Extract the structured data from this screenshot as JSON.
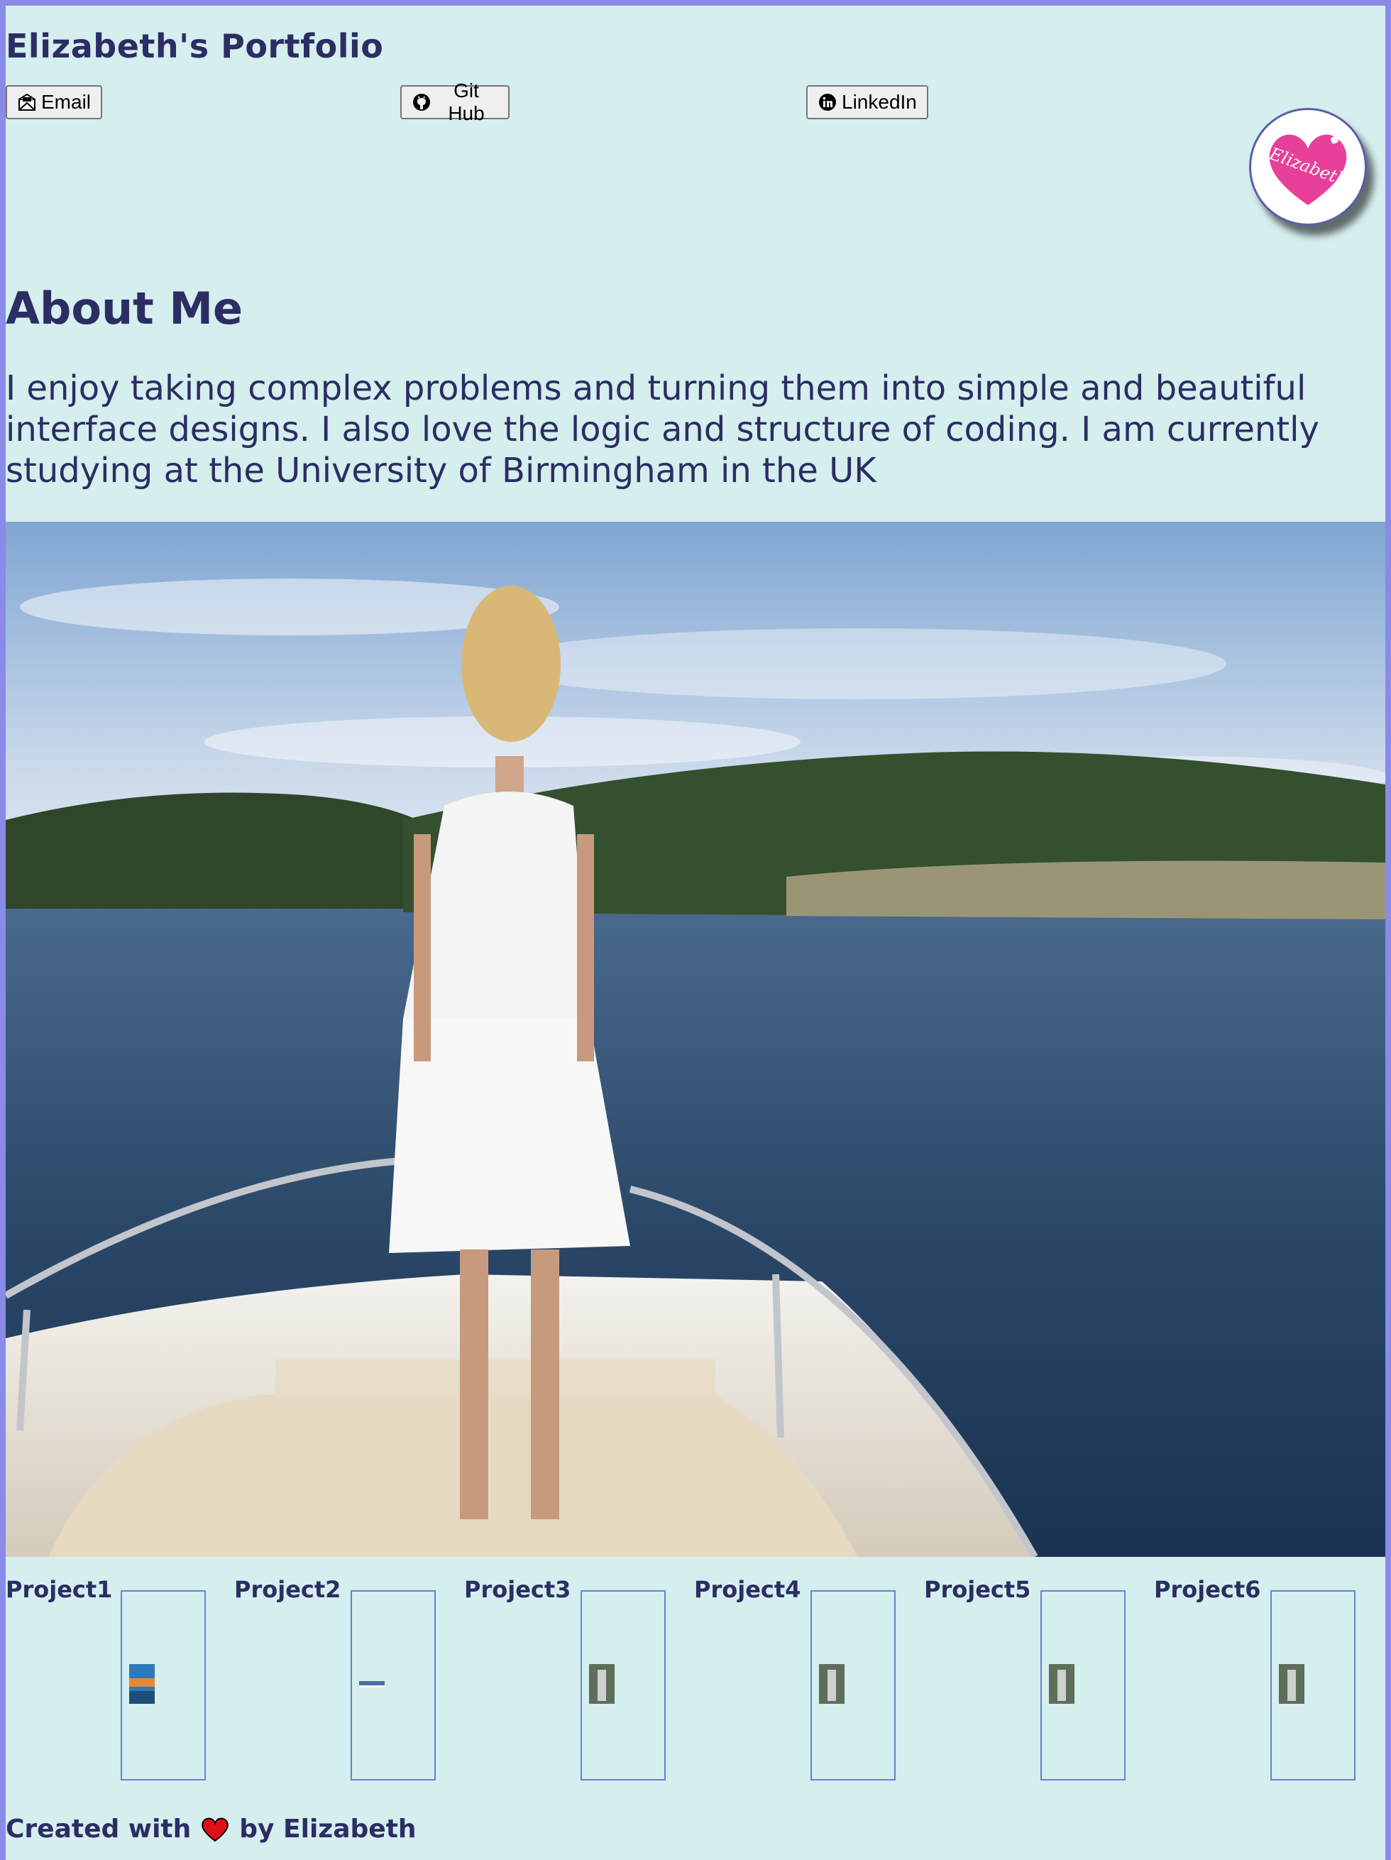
{
  "header": {
    "title": "Elizabeth's Portfolio",
    "buttons": {
      "email_label": "Email",
      "github_label": "Git Hub",
      "linkedin_label": "LinkedIn"
    },
    "logo_text": "Elizabeth"
  },
  "about": {
    "heading": "About Me",
    "text": "I enjoy taking complex problems and turning them into simple and beautiful interface designs. I also love the logic and structure of coding. I am currently studying at the University of Birmingham in the UK"
  },
  "projects": [
    {
      "label": "Project1"
    },
    {
      "label": "Project2"
    },
    {
      "label": "Project3"
    },
    {
      "label": "Project4"
    },
    {
      "label": "Project5"
    },
    {
      "label": "Project6"
    }
  ],
  "footer": {
    "prefix": "Created with",
    "suffix": "by Elizabeth"
  },
  "colors": {
    "page_background": "#d5eeee",
    "border_background": "#8a8ae8",
    "text": "#2b2d63",
    "logo_heart": "#e83f9a"
  }
}
